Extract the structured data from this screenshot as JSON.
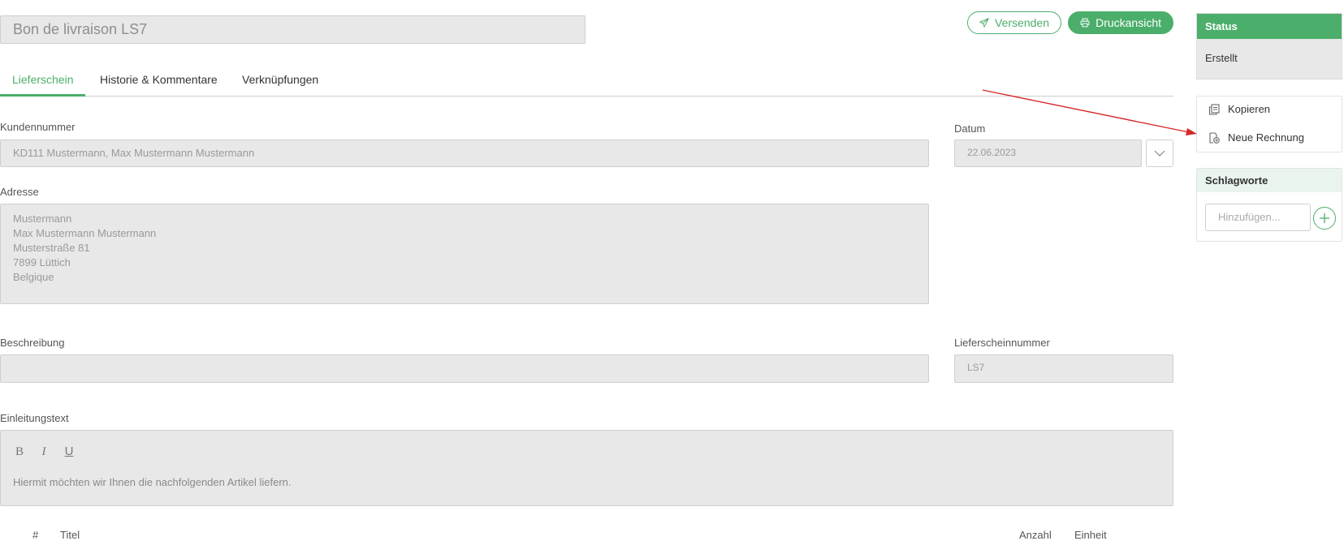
{
  "header": {
    "title_value": "Bon de livraison LS7",
    "send_label": "Versenden",
    "print_label": "Druckansicht"
  },
  "tabs": [
    {
      "label": "Lieferschein",
      "active": true
    },
    {
      "label": "Historie & Kommentare",
      "active": false
    },
    {
      "label": "Verknüpfungen",
      "active": false
    }
  ],
  "form": {
    "customer_label": "Kundennummer",
    "customer_value": "KD111 Mustermann, Max Mustermann Mustermann",
    "date_label": "Datum",
    "date_value": "22.06.2023",
    "address_label": "Adresse",
    "address_lines": [
      "Mustermann",
      "Max Mustermann Mustermann",
      "Musterstraße 81",
      "7899 Lüttich",
      "Belgique"
    ],
    "description_label": "Beschreibung",
    "description_value": "",
    "delivery_number_label": "Lieferscheinnummer",
    "delivery_number_value": "LS7",
    "intro_label": "Einleitungstext",
    "intro_text": "Hiermit möchten wir Ihnen die nachfolgenden Artikel liefern."
  },
  "editor_toolbar": {
    "bold": "B",
    "italic": "I",
    "underline": "U"
  },
  "table_header": {
    "num": "#",
    "title": "Titel",
    "qty": "Anzahl",
    "unit": "Einheit"
  },
  "sidebar": {
    "status_title": "Status",
    "status_value": "Erstellt",
    "actions": [
      {
        "label": "Kopieren",
        "icon": "copy-icon"
      },
      {
        "label": "Neue Rechnung",
        "icon": "new-invoice-icon"
      }
    ],
    "tags_title": "Schlagworte",
    "tags_placeholder": "Hinzufügen..."
  },
  "colors": {
    "accent": "#4cae6b",
    "field_bg": "#e8e8e8",
    "annotation_arrow": "#d62a2a"
  },
  "annotation": {
    "type": "arrow",
    "target": "Neue Rechnung"
  }
}
